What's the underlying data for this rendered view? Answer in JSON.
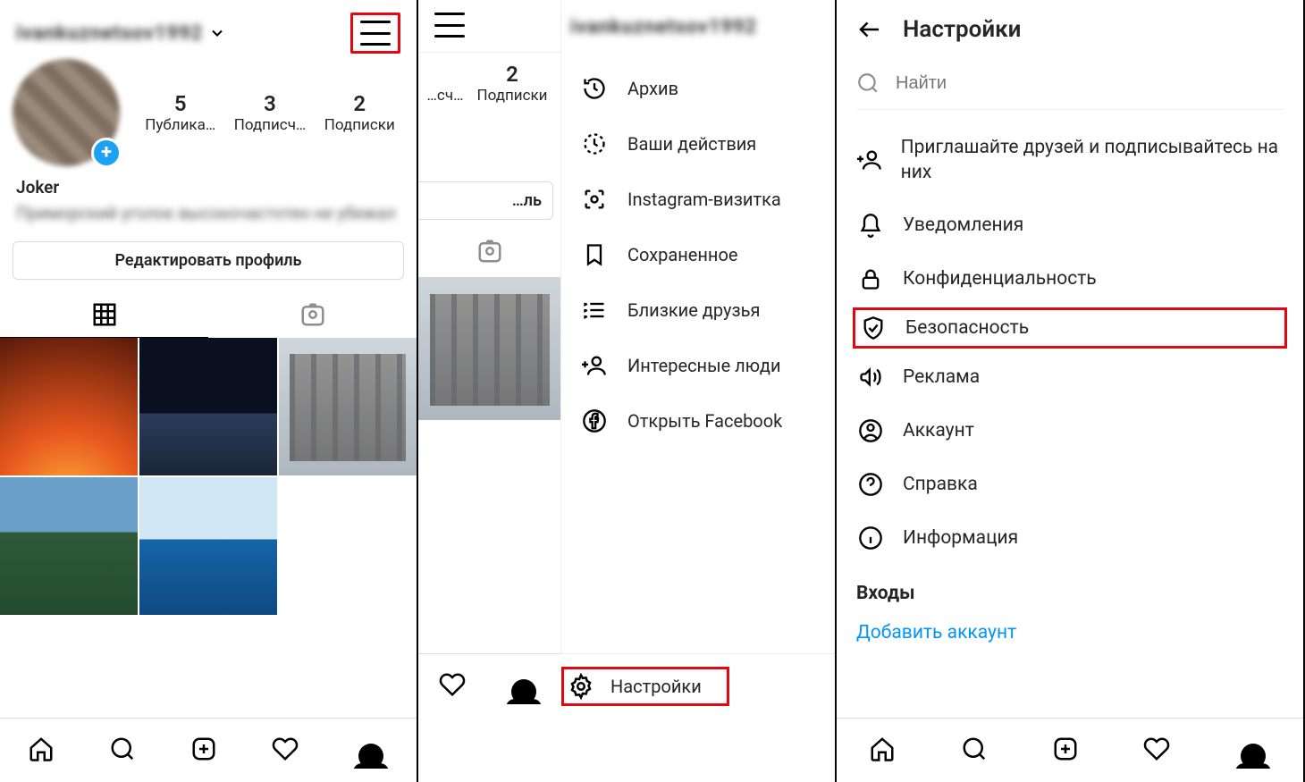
{
  "panel1": {
    "username_masked": "ivankuznetsov1992",
    "stats": {
      "posts": {
        "value": "5",
        "label": "Публика…"
      },
      "followers": {
        "value": "3",
        "label": "Подписч…"
      },
      "following": {
        "value": "2",
        "label": "Подписки"
      }
    },
    "bio_name": "Joker",
    "bio_text_masked": "Приморский уголок высокочастотен не убежал",
    "edit_profile": "Редактировать профиль"
  },
  "panel2": {
    "header_username_masked": "ivankuznetsov1992",
    "sliver_stats": {
      "followers": {
        "value": "",
        "label": "…сч…"
      },
      "following": {
        "value": "2",
        "label": "Подписки"
      }
    },
    "sliver_edit_tail": "…ль",
    "menu": {
      "archive": "Архив",
      "activity": "Ваши действия",
      "nametag": "Instagram-визитка",
      "saved": "Сохраненное",
      "close_friends": "Близкие друзья",
      "discover": "Интересные люди",
      "facebook": "Открыть Facebook"
    },
    "settings": "Настройки"
  },
  "panel3": {
    "title": "Настройки",
    "search_placeholder": "Найти",
    "items": {
      "invite": "Приглашайте друзей и подписывайтесь на них",
      "notif": "Уведомления",
      "privacy": "Конфиденциальность",
      "security": "Безопасность",
      "ads": "Реклама",
      "account": "Аккаунт",
      "help": "Справка",
      "about": "Информация"
    },
    "section_logins": "Входы",
    "add_account": "Добавить аккаунт"
  }
}
